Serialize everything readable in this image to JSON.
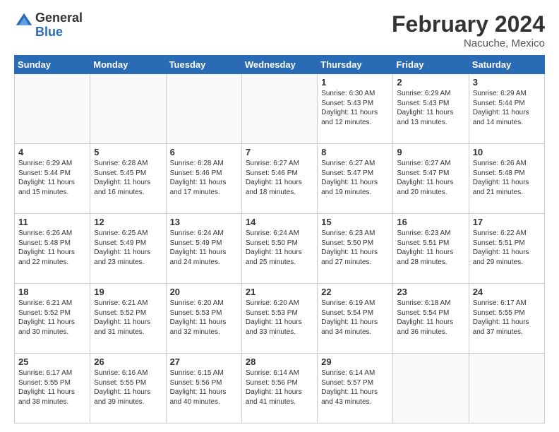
{
  "header": {
    "logo_general": "General",
    "logo_blue": "Blue",
    "title": "February 2024",
    "location": "Nacuche, Mexico"
  },
  "weekdays": [
    "Sunday",
    "Monday",
    "Tuesday",
    "Wednesday",
    "Thursday",
    "Friday",
    "Saturday"
  ],
  "weeks": [
    [
      {
        "day": "",
        "info": ""
      },
      {
        "day": "",
        "info": ""
      },
      {
        "day": "",
        "info": ""
      },
      {
        "day": "",
        "info": ""
      },
      {
        "day": "1",
        "info": "Sunrise: 6:30 AM\nSunset: 5:43 PM\nDaylight: 11 hours and 12 minutes."
      },
      {
        "day": "2",
        "info": "Sunrise: 6:29 AM\nSunset: 5:43 PM\nDaylight: 11 hours and 13 minutes."
      },
      {
        "day": "3",
        "info": "Sunrise: 6:29 AM\nSunset: 5:44 PM\nDaylight: 11 hours and 14 minutes."
      }
    ],
    [
      {
        "day": "4",
        "info": "Sunrise: 6:29 AM\nSunset: 5:44 PM\nDaylight: 11 hours and 15 minutes."
      },
      {
        "day": "5",
        "info": "Sunrise: 6:28 AM\nSunset: 5:45 PM\nDaylight: 11 hours and 16 minutes."
      },
      {
        "day": "6",
        "info": "Sunrise: 6:28 AM\nSunset: 5:46 PM\nDaylight: 11 hours and 17 minutes."
      },
      {
        "day": "7",
        "info": "Sunrise: 6:27 AM\nSunset: 5:46 PM\nDaylight: 11 hours and 18 minutes."
      },
      {
        "day": "8",
        "info": "Sunrise: 6:27 AM\nSunset: 5:47 PM\nDaylight: 11 hours and 19 minutes."
      },
      {
        "day": "9",
        "info": "Sunrise: 6:27 AM\nSunset: 5:47 PM\nDaylight: 11 hours and 20 minutes."
      },
      {
        "day": "10",
        "info": "Sunrise: 6:26 AM\nSunset: 5:48 PM\nDaylight: 11 hours and 21 minutes."
      }
    ],
    [
      {
        "day": "11",
        "info": "Sunrise: 6:26 AM\nSunset: 5:48 PM\nDaylight: 11 hours and 22 minutes."
      },
      {
        "day": "12",
        "info": "Sunrise: 6:25 AM\nSunset: 5:49 PM\nDaylight: 11 hours and 23 minutes."
      },
      {
        "day": "13",
        "info": "Sunrise: 6:24 AM\nSunset: 5:49 PM\nDaylight: 11 hours and 24 minutes."
      },
      {
        "day": "14",
        "info": "Sunrise: 6:24 AM\nSunset: 5:50 PM\nDaylight: 11 hours and 25 minutes."
      },
      {
        "day": "15",
        "info": "Sunrise: 6:23 AM\nSunset: 5:50 PM\nDaylight: 11 hours and 27 minutes."
      },
      {
        "day": "16",
        "info": "Sunrise: 6:23 AM\nSunset: 5:51 PM\nDaylight: 11 hours and 28 minutes."
      },
      {
        "day": "17",
        "info": "Sunrise: 6:22 AM\nSunset: 5:51 PM\nDaylight: 11 hours and 29 minutes."
      }
    ],
    [
      {
        "day": "18",
        "info": "Sunrise: 6:21 AM\nSunset: 5:52 PM\nDaylight: 11 hours and 30 minutes."
      },
      {
        "day": "19",
        "info": "Sunrise: 6:21 AM\nSunset: 5:52 PM\nDaylight: 11 hours and 31 minutes."
      },
      {
        "day": "20",
        "info": "Sunrise: 6:20 AM\nSunset: 5:53 PM\nDaylight: 11 hours and 32 minutes."
      },
      {
        "day": "21",
        "info": "Sunrise: 6:20 AM\nSunset: 5:53 PM\nDaylight: 11 hours and 33 minutes."
      },
      {
        "day": "22",
        "info": "Sunrise: 6:19 AM\nSunset: 5:54 PM\nDaylight: 11 hours and 34 minutes."
      },
      {
        "day": "23",
        "info": "Sunrise: 6:18 AM\nSunset: 5:54 PM\nDaylight: 11 hours and 36 minutes."
      },
      {
        "day": "24",
        "info": "Sunrise: 6:17 AM\nSunset: 5:55 PM\nDaylight: 11 hours and 37 minutes."
      }
    ],
    [
      {
        "day": "25",
        "info": "Sunrise: 6:17 AM\nSunset: 5:55 PM\nDaylight: 11 hours and 38 minutes."
      },
      {
        "day": "26",
        "info": "Sunrise: 6:16 AM\nSunset: 5:55 PM\nDaylight: 11 hours and 39 minutes."
      },
      {
        "day": "27",
        "info": "Sunrise: 6:15 AM\nSunset: 5:56 PM\nDaylight: 11 hours and 40 minutes."
      },
      {
        "day": "28",
        "info": "Sunrise: 6:14 AM\nSunset: 5:56 PM\nDaylight: 11 hours and 41 minutes."
      },
      {
        "day": "29",
        "info": "Sunrise: 6:14 AM\nSunset: 5:57 PM\nDaylight: 11 hours and 43 minutes."
      },
      {
        "day": "",
        "info": ""
      },
      {
        "day": "",
        "info": ""
      }
    ]
  ]
}
